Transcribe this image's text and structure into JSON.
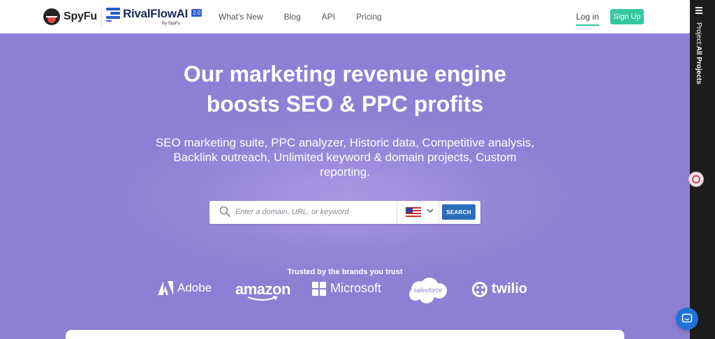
{
  "header": {
    "spyfu_logo_text": "SpyFu",
    "rival_logo_text": "RivalFlowAI",
    "rival_badge": "2.0",
    "rival_by": "By SpyFu",
    "nav": [
      "What's New",
      "Blog",
      "API",
      "Pricing"
    ],
    "login_label": "Log in",
    "signup_label": "Sign Up"
  },
  "hero": {
    "headline_line1": "Our marketing revenue engine",
    "headline_line2": "boosts SEO & PPC profits",
    "subline": "SEO marketing suite, PPC analyzer, Historic data, Competitive analysis, Backlink outreach, Unlimited keyword & domain projects, Custom reporting.",
    "search": {
      "placeholder": "Enter a domain, URL, or keyword",
      "country_icon": "us-flag-icon",
      "button_label": "SEARCH"
    },
    "trusted_label": "Trusted by the brands you trust",
    "brands": [
      "Adobe",
      "amazon",
      "Microsoft",
      "salesforce",
      "twilio"
    ]
  },
  "sidebar": {
    "label_prefix": "Project:",
    "label_value": "All Projects"
  },
  "colors": {
    "hero_bg": "#8f7fd4",
    "accent_green": "#33c7a0",
    "search_button": "#2a6ebb",
    "chat_button": "#1f73d8"
  }
}
